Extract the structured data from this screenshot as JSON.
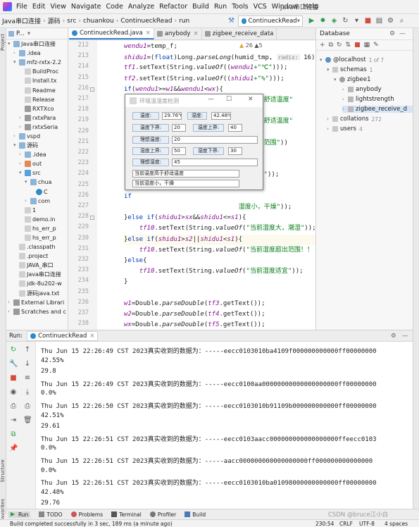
{
  "menubar": {
    "items": [
      "File",
      "Edit",
      "View",
      "Navigate",
      "Code",
      "Analyze",
      "Refactor",
      "Build",
      "Run",
      "Tools",
      "VCS",
      "Window",
      "Help"
    ],
    "window_title": "Java串口连接"
  },
  "navbar": {
    "crumbs": [
      "Java串口连接",
      "源码",
      "src",
      "chuankou",
      "ContinueckRead",
      "run"
    ],
    "run_config": "ContinueckRead"
  },
  "project": {
    "header": "P...",
    "items": [
      {
        "label": "Java串口连接",
        "depth": 0,
        "icon": "folder",
        "open": true
      },
      {
        "label": ".idea",
        "depth": 1,
        "icon": "folder",
        "open": false
      },
      {
        "label": "mfz-rxtx-2.2",
        "depth": 1,
        "icon": "folder",
        "open": true
      },
      {
        "label": "BuildProc",
        "depth": 2,
        "icon": "file"
      },
      {
        "label": "Install.tx",
        "depth": 2,
        "icon": "file"
      },
      {
        "label": "Readme",
        "depth": 2,
        "icon": "file"
      },
      {
        "label": "Release",
        "depth": 2,
        "icon": "file"
      },
      {
        "label": "RXTXco",
        "depth": 2,
        "icon": "lib"
      },
      {
        "label": "rxtxPara",
        "depth": 2,
        "icon": "lib",
        "open": false
      },
      {
        "label": "rxtxSeria",
        "depth": 2,
        "icon": "lib",
        "open": false
      },
      {
        "label": "vspd",
        "depth": 1,
        "icon": "folder",
        "open": false
      },
      {
        "label": "源码",
        "depth": 1,
        "icon": "folder",
        "open": true
      },
      {
        "label": ".idea",
        "depth": 2,
        "icon": "folder",
        "open": false
      },
      {
        "label": "out",
        "depth": 2,
        "icon": "excl",
        "open": false
      },
      {
        "label": "src",
        "depth": 2,
        "icon": "src",
        "open": true
      },
      {
        "label": "chua",
        "depth": 3,
        "icon": "folder",
        "open": true
      },
      {
        "label": "C",
        "depth": 4,
        "icon": "class"
      },
      {
        "label": "com",
        "depth": 3,
        "icon": "folder",
        "open": false
      },
      {
        "label": "1",
        "depth": 2,
        "icon": "file"
      },
      {
        "label": "demo.in",
        "depth": 2,
        "icon": "file"
      },
      {
        "label": "hs_err_p",
        "depth": 2,
        "icon": "file"
      },
      {
        "label": "hs_err_p",
        "depth": 2,
        "icon": "file"
      },
      {
        "label": ".classpath",
        "depth": 1,
        "icon": "file"
      },
      {
        "label": ".project",
        "depth": 1,
        "icon": "file"
      },
      {
        "label": "JAVA_串口",
        "depth": 1,
        "icon": "file"
      },
      {
        "label": "Java串口连接",
        "depth": 1,
        "icon": "file"
      },
      {
        "label": "jdk-8u202-w",
        "depth": 1,
        "icon": "file"
      },
      {
        "label": "源码java.txt",
        "depth": 1,
        "icon": "file"
      },
      {
        "label": "External Librari",
        "depth": 0,
        "icon": "lib",
        "open": false
      },
      {
        "label": "Scratches and c",
        "depth": 0,
        "icon": "lib",
        "open": false
      }
    ]
  },
  "tabs": [
    {
      "label": "ContinueckRead.java",
      "active": true,
      "color": "#2e8bc7"
    },
    {
      "label": "anybody",
      "active": false,
      "color": "#9a9a9a"
    },
    {
      "label": "zigbee_receive_data",
      "active": false,
      "color": "#9a9a9a"
    }
  ],
  "inspections": "26 ▲5",
  "code": {
    "lines": [
      {
        "n": "212",
        "parts": [
          [
            "fld",
            "wendu1"
          ],
          [
            "",
            "=temp_f;"
          ]
        ]
      },
      {
        "n": "213",
        "parts": [
          [
            "fld",
            "shidu1"
          ],
          [
            "",
            "=("
          ],
          [
            "kw",
            "float"
          ],
          [
            "",
            ")Long."
          ],
          [
            "it",
            "parseLong"
          ],
          [
            "",
            "(humid_tmp, "
          ],
          [
            "hint",
            "radix:"
          ],
          [
            "",
            " 16)/1"
          ]
        ]
      },
      {
        "n": "214",
        "parts": [
          [
            "fld",
            "tf1"
          ],
          [
            "",
            ".setText(String."
          ],
          [
            "it",
            "valueOf"
          ],
          [
            "",
            "(("
          ],
          [
            "fld",
            "wendu1"
          ],
          [
            "",
            ""
          ],
          [
            "str",
            "+\"℃\""
          ],
          [
            "",
            ")));"
          ]
        ]
      },
      {
        "n": "215",
        "parts": [
          [
            "fld",
            "tf2"
          ],
          [
            "",
            ".setText(String."
          ],
          [
            "it",
            "valueOf"
          ],
          [
            "",
            "(("
          ],
          [
            "fld",
            "shidu1"
          ],
          [
            "str",
            "+\"%\""
          ],
          [
            "",
            ")));"
          ]
        ]
      },
      {
        "n": "216",
        "parts": [
          [
            "kw",
            "if"
          ],
          [
            "",
            "("
          ],
          [
            "fld",
            "wendu1"
          ],
          [
            "",
            ">="
          ],
          [
            "fld",
            "w1"
          ],
          [
            "",
            "&&"
          ],
          [
            "fld",
            "wendu1"
          ],
          [
            "",
            "<"
          ],
          [
            "fld",
            "wx"
          ],
          [
            "",
            "){"
          ]
        ]
      },
      {
        "n": "217",
        "parts": [
          [
            "",
            "                              "
          ],
          [
            "str",
            "温度低于舒适温度\""
          ]
        ]
      },
      {
        "n": "218",
        "parts": [
          [
            "",
            "}"
          ]
        ]
      },
      {
        "n": "219",
        "parts": [
          [
            "",
            "                              "
          ],
          [
            "str",
            "温度高于舒适温度\""
          ]
        ]
      },
      {
        "n": "220",
        "parts": [
          [
            "",
            "}"
          ]
        ]
      },
      {
        "n": "221",
        "parts": [
          [
            "",
            "                              "
          ],
          [
            "str",
            "温度超出范围\""
          ],
          [
            "",
            "))"
          ]
        ]
      },
      {
        "n": "222",
        "parts": [
          [
            "",
            ""
          ]
        ]
      },
      {
        "n": "223",
        "parts": [
          [
            "",
            "}"
          ]
        ]
      },
      {
        "n": "224",
        "parts": [
          [
            "",
            "                              "
          ],
          [
            "str",
            "温度适宜\""
          ],
          [
            "",
            "));"
          ]
        ]
      },
      {
        "n": "225",
        "parts": [
          [
            "",
            "}"
          ]
        ]
      },
      {
        "n": "226",
        "parts": [
          [
            "kw",
            "if"
          ]
        ]
      },
      {
        "n": "227",
        "parts": [
          [
            "",
            "                              "
          ],
          [
            "str",
            "湿度小，干燥\""
          ],
          [
            "",
            "));"
          ]
        ]
      },
      {
        "n": "228",
        "parts": [
          [
            "",
            "}"
          ],
          [
            "kw",
            "else if"
          ],
          [
            "",
            "("
          ],
          [
            "fld",
            "shidu1"
          ],
          [
            "",
            ">"
          ],
          [
            "fld",
            "sx"
          ],
          [
            "",
            "&&"
          ],
          [
            "fld",
            "shidu1"
          ],
          [
            "",
            "<="
          ],
          [
            "fld",
            "s1"
          ],
          [
            "",
            "){"
          ]
        ]
      },
      {
        "n": "229",
        "parts": [
          [
            "",
            "    "
          ],
          [
            "fld",
            "tf10"
          ],
          [
            "",
            ".setText(String."
          ],
          [
            "it",
            "valueOf"
          ],
          [
            "",
            "("
          ],
          [
            "str",
            "\"当前湿度大，潮湿\""
          ],
          [
            "",
            "));"
          ]
        ]
      },
      {
        "n": "230",
        "parts": [
          [
            "",
            "}"
          ],
          [
            "kw",
            "else if"
          ],
          [
            "",
            "("
          ],
          [
            "fld",
            "shidu1"
          ],
          [
            "",
            ">"
          ],
          [
            "fld",
            "s2"
          ],
          [
            "",
            "||"
          ],
          [
            "fld",
            "shidu1"
          ],
          [
            "",
            "<"
          ],
          [
            "fld",
            "s1"
          ],
          [
            "",
            "){"
          ]
        ]
      },
      {
        "n": "231",
        "parts": [
          [
            "",
            "    "
          ],
          [
            "fld",
            "tf10"
          ],
          [
            "",
            ".setText(String."
          ],
          [
            "it",
            "valueOf"
          ],
          [
            "",
            "("
          ],
          [
            "str",
            "\"当前湿度超出范围！！"
          ]
        ]
      },
      {
        "n": "232",
        "parts": [
          [
            "",
            "}"
          ],
          [
            "kw",
            "else"
          ],
          [
            "",
            "{"
          ]
        ]
      },
      {
        "n": "233",
        "parts": [
          [
            "",
            "    "
          ],
          [
            "fld",
            "tf10"
          ],
          [
            "",
            ".setText(String."
          ],
          [
            "it",
            "valueOf"
          ],
          [
            "",
            "("
          ],
          [
            "str",
            "\"当前湿度适宜\""
          ],
          [
            "",
            "));"
          ]
        ]
      },
      {
        "n": "234",
        "parts": [
          [
            "",
            "}"
          ]
        ]
      },
      {
        "n": "235",
        "parts": [
          [
            "",
            ""
          ]
        ]
      },
      {
        "n": "236",
        "parts": [
          [
            "fld",
            "w1"
          ],
          [
            "",
            "=Double."
          ],
          [
            "it",
            "parseDouble"
          ],
          [
            "",
            "("
          ],
          [
            "fld",
            "tf3"
          ],
          [
            "",
            ".getText());"
          ]
        ]
      },
      {
        "n": "237",
        "parts": [
          [
            "fld",
            "w2"
          ],
          [
            "",
            "=Double."
          ],
          [
            "it",
            "parseDouble"
          ],
          [
            "",
            "("
          ],
          [
            "fld",
            "tf4"
          ],
          [
            "",
            ".getText());"
          ]
        ]
      },
      {
        "n": "238",
        "parts": [
          [
            "fld",
            "wx"
          ],
          [
            "",
            "=Double."
          ],
          [
            "it",
            "parseDouble"
          ],
          [
            "",
            "("
          ],
          [
            "fld",
            "tf5"
          ],
          [
            "",
            ".getText());"
          ]
        ]
      },
      {
        "n": "239",
        "parts": [
          [
            "fld",
            "s1"
          ],
          [
            "",
            "=Double."
          ],
          [
            "it",
            "parseDouble"
          ],
          [
            "",
            "("
          ],
          [
            "fld",
            "tf6"
          ],
          [
            "",
            ".getText());"
          ]
        ]
      },
      {
        "n": "240",
        "parts": [
          [
            "fld",
            "s2"
          ],
          [
            "",
            "=Double."
          ],
          [
            "it",
            "parseDouble"
          ],
          [
            "",
            "("
          ],
          [
            "fld",
            "tf7"
          ],
          [
            "",
            ".getText());"
          ]
        ]
      }
    ]
  },
  "dialog": {
    "title": "环境温湿度检测",
    "temp_label": "温度:",
    "temp_value": "29.76℃",
    "humid_label": "湿度:",
    "humid_value": "42.48%",
    "temp_low_label": "温度下界:",
    "temp_low_value": "20",
    "temp_high_label": "温度上界:",
    "temp_high_value": "40",
    "ideal_temp_label": "理想温度:",
    "ideal_temp_value": "20",
    "humid_high_label": "湿度上界:",
    "humid_high_value": "50",
    "humid_low_label": "湿度下界:",
    "humid_low_value": "30",
    "ideal_humid_label": "理想湿度:",
    "ideal_humid_value": "45",
    "temp_status": "当前温度高于舒适温度",
    "humid_status": "当前湿度小，干燥"
  },
  "database": {
    "title": "Database",
    "host": "@localhost",
    "host_count": "1 of 7",
    "schemas_label": "schemas",
    "schemas_count": "1",
    "db_name": "zigbee1",
    "tables": [
      "anybody",
      "lightstrength",
      "zigbee_receive_d"
    ],
    "collations_label": "collations",
    "collations_count": "272",
    "users_label": "users",
    "users_count": "4"
  },
  "run": {
    "label": "Run:",
    "tab": "ContinueckRead",
    "console_lines": [
      "Thu Jun 15 22:26:49 CST 2023真实收到的数据为：-----eecc0103010ba4109f000000000000ff00000000",
      "42.55%",
      "29.8",
      "Thu Jun 15 22:26:49 CST 2023真实收到的数据为：-----eecc0100aa00000000000000000000ff00000000",
      "0.0%",
      "Thu Jun 15 22:26:50 CST 2023真实收到的数据为：-----eecc0103010b91109b000000000000ff00000000",
      "42.51%",
      "29.61",
      "Thu Jun 15 22:26:51 CST 2023真实收到的数据为：-----eecc0103aacc000000000000000000ffeecc0103",
      "0.0%",
      "Thu Jun 15 22:26:51 CST 2023真实收到的数据为：-----aacc000000000000000000ff000000000000000",
      "0.0%",
      "Thu Jun 15 22:26:51 CST 2023真实收到的数据为：-----eecc0103010ba01098000000000000ff00000000",
      "42.48%",
      "29.76"
    ]
  },
  "bottom_tabs": [
    "Run",
    "TODO",
    "Problems",
    "Terminal",
    "Profiler",
    "Build"
  ],
  "left_strip": [
    "Project",
    "Structure",
    "Favorites"
  ],
  "status": {
    "message": "Build completed successfully in 3 sec, 189 ms (a minute ago)",
    "position": "230:54",
    "line_sep": "CRLF",
    "encoding": "UTF-8",
    "indent": "4 spaces"
  },
  "watermark": "CSDN @bruce江小白"
}
